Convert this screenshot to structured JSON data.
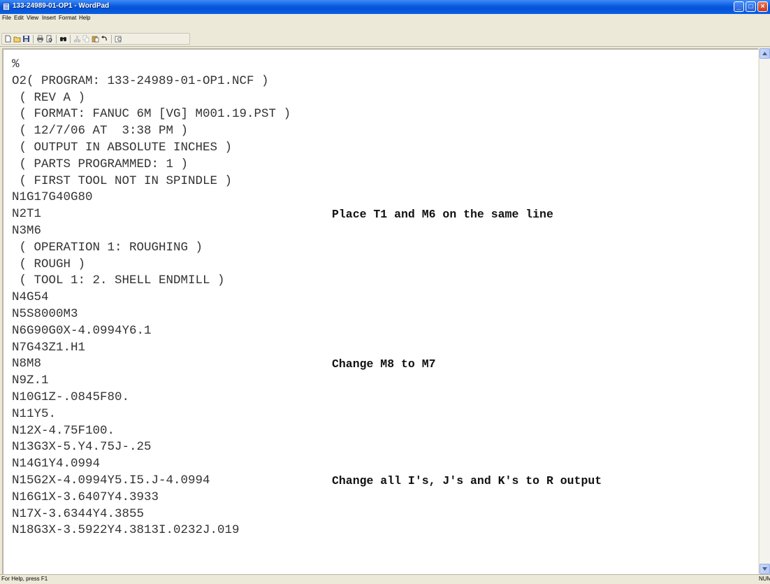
{
  "window": {
    "title": "133-24989-01-OP1 - WordPad",
    "minimize_glyph": "_",
    "maximize_glyph": "□",
    "close_glyph": "×"
  },
  "menu": [
    "File",
    "Edit",
    "View",
    "Insert",
    "Format",
    "Help"
  ],
  "toolbar": {
    "icons": [
      "new-icon",
      "open-icon",
      "save-icon",
      "print-icon",
      "print-preview-icon",
      "find-icon",
      "cut-icon",
      "copy-icon",
      "paste-icon",
      "undo-icon",
      "insert-datetime-icon"
    ]
  },
  "document": {
    "lines": [
      "%",
      "O2( PROGRAM: 133-24989-01-OP1.NCF )",
      " ( REV A )",
      " ( FORMAT: FANUC 6M [VG] M001.19.PST )",
      " ( 12/7/06 AT  3:38 PM )",
      " ( OUTPUT IN ABSOLUTE INCHES )",
      " ( PARTS PROGRAMMED: 1 )",
      " ( FIRST TOOL NOT IN SPINDLE )",
      "N1G17G40G80",
      "N2T1",
      "N3M6",
      " ( OPERATION 1: ROUGHING )",
      " ( ROUGH )",
      " ( TOOL 1: 2. SHELL ENDMILL )",
      "N4G54",
      "N5S8000M3",
      "N6G90G0X-4.0994Y6.1",
      "N7G43Z1.H1",
      "N8M8",
      "N9Z.1",
      "N10G1Z-.0845F80.",
      "N11Y5.",
      "N12X-4.75F100.",
      "N13G3X-5.Y4.75J-.25",
      "N14G1Y4.0994",
      "N15G2X-4.0994Y5.I5.J-4.0994",
      "N16G1X-3.6407Y4.3933",
      "N17X-3.6344Y4.3855",
      "N18G3X-3.5922Y4.3813I.0232J.019"
    ],
    "notes": [
      {
        "line": 9,
        "text": "Place T1 and M6 on the same line"
      },
      {
        "line": 18,
        "text": "Change M8 to M7"
      },
      {
        "line": 25,
        "text": "Change all I's, J's and K's to R output"
      }
    ]
  },
  "status": {
    "help_text": "For Help, press F1",
    "num_indicator": "NUM"
  }
}
